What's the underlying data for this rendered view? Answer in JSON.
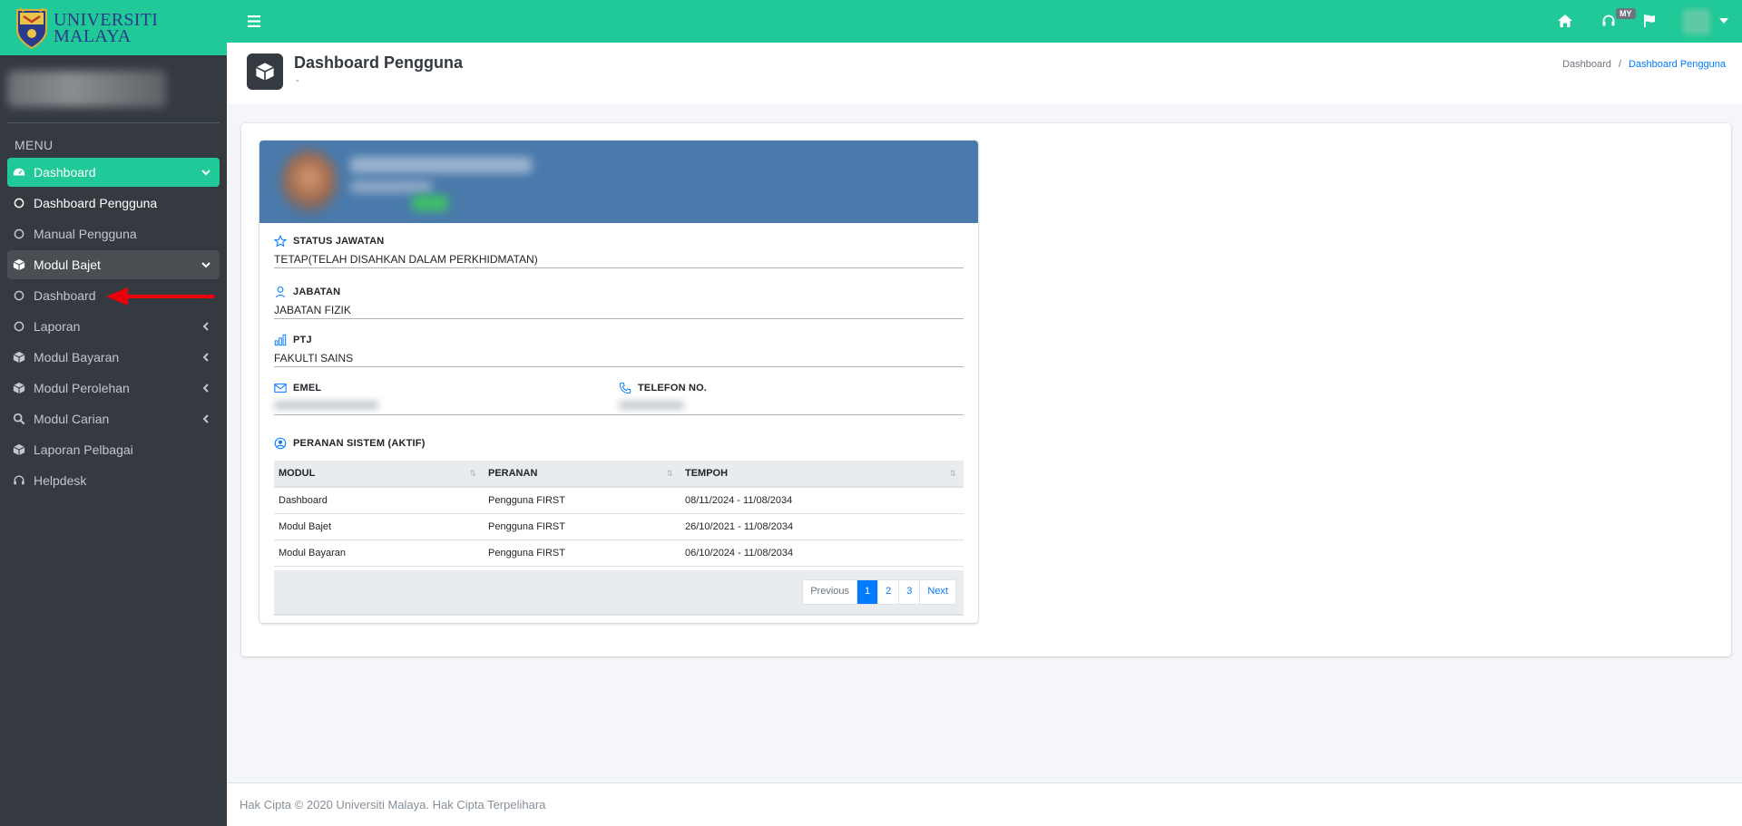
{
  "brand": {
    "line1": "UNIVERSITI",
    "line2": "MALAYA"
  },
  "sidebar": {
    "menu_header": "MENU",
    "items": [
      {
        "label": "Dashboard",
        "icon": "tachometer-icon",
        "state": "active",
        "caret": "down"
      },
      {
        "label": "Dashboard Pengguna",
        "icon": "circle-icon",
        "state": "current"
      },
      {
        "label": "Manual Pengguna",
        "icon": "circle-icon"
      },
      {
        "label": "Modul Bajet",
        "icon": "cube-icon",
        "state": "open",
        "caret": "down"
      },
      {
        "label": "Dashboard",
        "icon": "circle-icon"
      },
      {
        "label": "Laporan",
        "icon": "circle-icon",
        "caret": "left"
      },
      {
        "label": "Modul Bayaran",
        "icon": "cube-icon",
        "caret": "left"
      },
      {
        "label": "Modul Perolehan",
        "icon": "cube-icon",
        "caret": "left"
      },
      {
        "label": "Modul Carian",
        "icon": "search-icon",
        "caret": "left"
      },
      {
        "label": "Laporan Pelbagai",
        "icon": "cube-icon"
      },
      {
        "label": "Helpdesk",
        "icon": "headset-icon"
      }
    ]
  },
  "topbar": {
    "lang": "MY",
    "icons": [
      "menu-icon",
      "home-icon",
      "headset-icon",
      "flag-icon",
      "caret-down-icon"
    ]
  },
  "header": {
    "title": "Dashboard Pengguna",
    "subtitle": "-",
    "breadcrumb": [
      "Dashboard",
      "Dashboard Pengguna"
    ]
  },
  "profile": {
    "status_label": "STATUS JAWATAN",
    "status_value": "TETAP(TELAH DISAHKAN DALAM PERKHIDMATAN)",
    "jabatan_label": "JABATAN",
    "jabatan_value": "JABATAN FIZIK",
    "ptj_label": "PTJ",
    "ptj_value": "FAKULTI SAINS",
    "emel_label": "EMEL",
    "telefon_label": "TELEFON NO.",
    "roles_label": "PERANAN SISTEM (AKTIF)"
  },
  "roles_table": {
    "columns": [
      "MODUL",
      "PERANAN",
      "TEMPOH"
    ],
    "rows": [
      [
        "Dashboard",
        "Pengguna FIRST",
        "08/11/2024 - 11/08/2034"
      ],
      [
        "Modul Bajet",
        "Pengguna FIRST",
        "26/10/2021 - 11/08/2034"
      ],
      [
        "Modul Bayaran",
        "Pengguna FIRST",
        "06/10/2024 - 11/08/2034"
      ]
    ]
  },
  "pagination": {
    "previous": "Previous",
    "pages": [
      "1",
      "2",
      "3"
    ],
    "active_page": "1",
    "next": "Next"
  },
  "footer": {
    "text": "Hak Cipta © 2020 Universiti Malaya. Hak Cipta Terpelihara"
  },
  "colors": {
    "accent": "#20c997",
    "sidebar": "#343a40",
    "profile_header": "#4a7aab",
    "link": "#007bff"
  }
}
